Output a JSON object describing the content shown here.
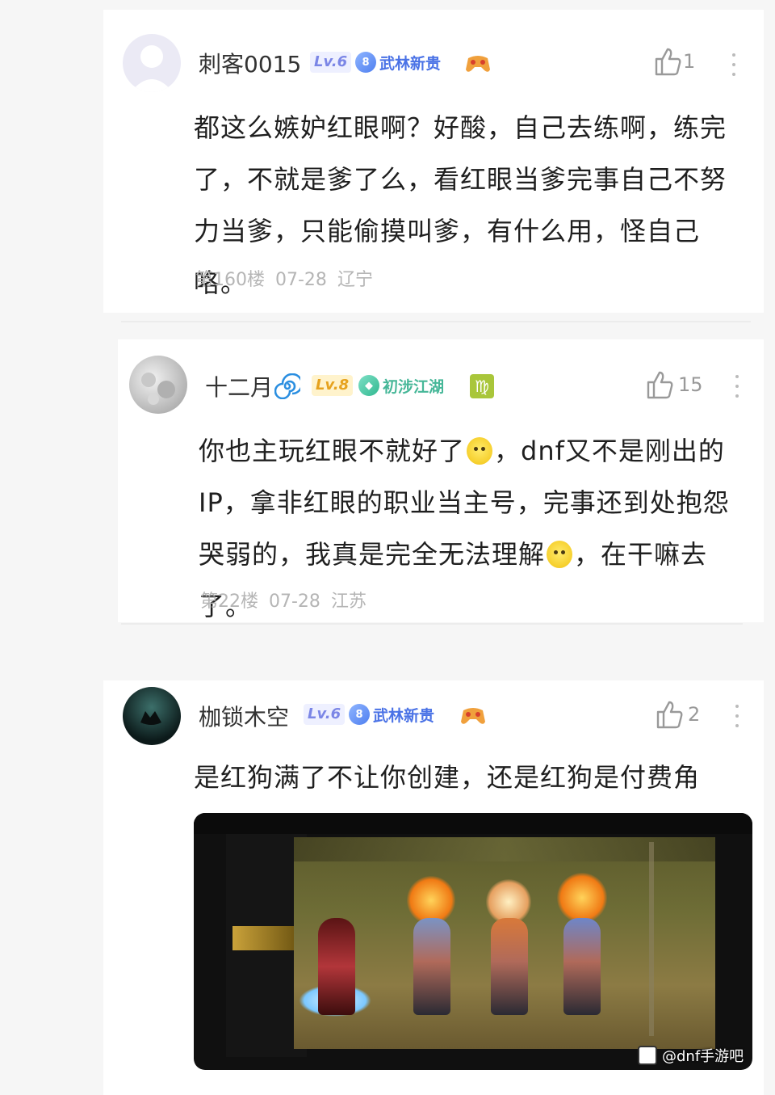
{
  "comments": [
    {
      "username": "刺客0015",
      "level": "Lv.6",
      "title_badge": "武林新贵",
      "shield_number": "8",
      "likes": "1",
      "content": "都这么嫉妒红眼啊？好酸，自己去练啊，练完了，不就是爹了么，看红眼当爹完事自己不努力当爹，只能偷摸叫爹，有什么用，怪自己咯。",
      "floor": "第160楼",
      "date": "07-28",
      "location": "辽宁"
    },
    {
      "username": "十二月",
      "level": "Lv.8",
      "title_badge": "初涉江湖",
      "likes": "15",
      "content_parts": [
        "你也主玩红眼不就好了",
        "，dnf又不是刚出的IP，拿非红眼的职业当主号，完事还到处抱怨哭弱的，我真是完全无法理解",
        "，在干嘛去了。"
      ],
      "floor": "第22楼",
      "date": "07-28",
      "location": "江苏"
    },
    {
      "username": "枷锁木空",
      "level": "Lv.6",
      "title_badge": "武林新贵",
      "shield_number": "8",
      "likes": "2",
      "content": "是红狗满了不让你创建，还是红狗是付费角色？"
    }
  ],
  "watermark": "@dnf手游吧"
}
